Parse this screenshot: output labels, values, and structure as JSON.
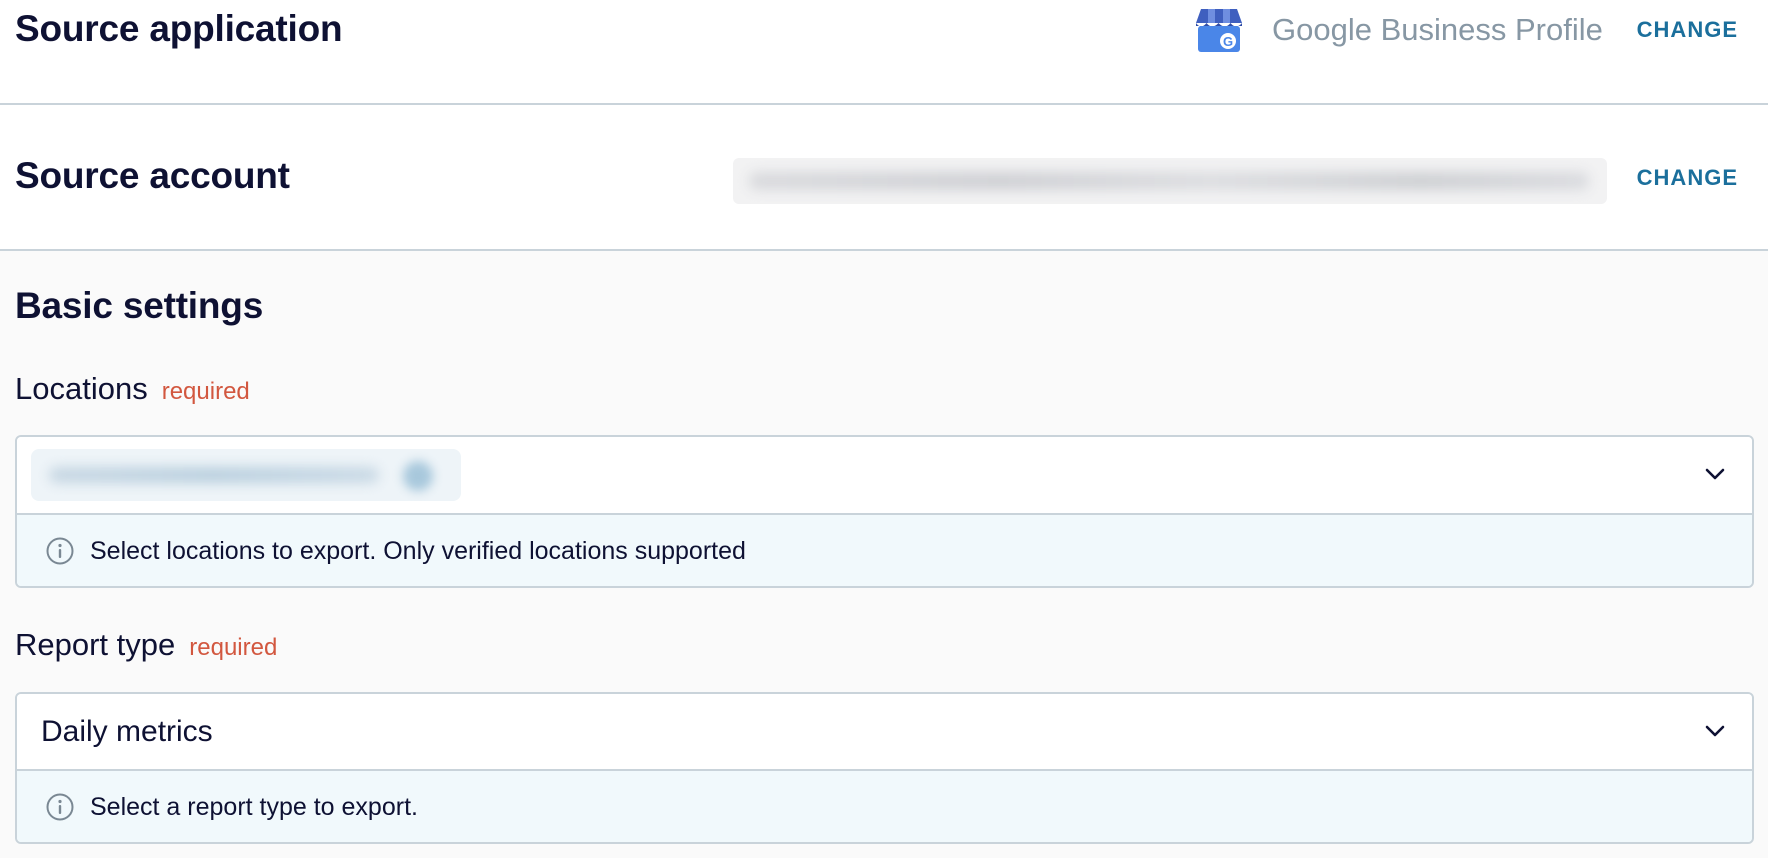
{
  "source_application": {
    "title": "Source application",
    "app_name": "Google Business Profile",
    "logo_icon": "google-business-profile-icon",
    "change_label": "CHANGE"
  },
  "source_account": {
    "title": "Source account",
    "change_label": "CHANGE"
  },
  "basic_settings": {
    "title": "Basic settings",
    "locations": {
      "label": "Locations",
      "required_label": "required",
      "hint": "Select locations to export. Only verified locations supported"
    },
    "report_type": {
      "label": "Report type",
      "required_label": "required",
      "value": "Daily metrics",
      "hint": "Select a report type to export."
    }
  },
  "colors": {
    "accent": "#1b6f9c",
    "required": "#d2573f",
    "heading": "#0e1133",
    "hint_background": "#f1f9fc"
  }
}
